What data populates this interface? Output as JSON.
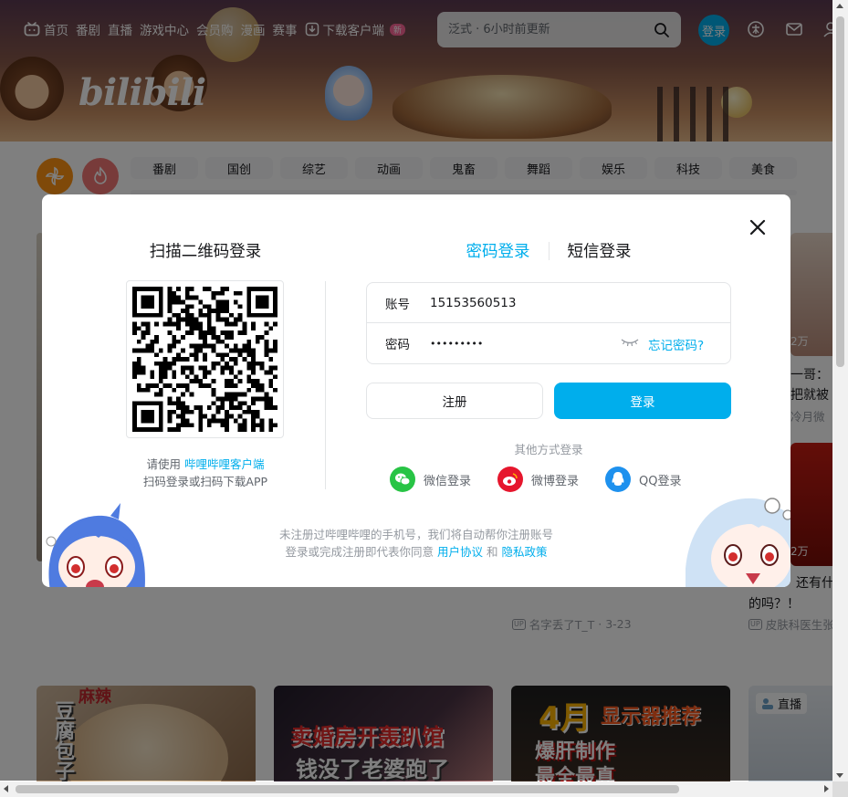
{
  "header": {
    "nav": [
      {
        "label": "首页",
        "icon": "tv-icon"
      },
      {
        "label": "番剧"
      },
      {
        "label": "直播"
      },
      {
        "label": "游戏中心"
      },
      {
        "label": "会员购"
      },
      {
        "label": "漫画"
      },
      {
        "label": "赛事"
      },
      {
        "label": "下载客户端",
        "icon": "download-icon",
        "badge": "新"
      }
    ],
    "search_placeholder": "泛式 · 6小时前更新",
    "login_avatar_label": "登录",
    "banner_logo": "bilibili"
  },
  "channels": {
    "items": [
      "番剧",
      "国创",
      "综艺",
      "动画",
      "鬼畜",
      "舞蹈",
      "娱乐",
      "科技",
      "美食"
    ]
  },
  "feed": {
    "right_card_1": {
      "views": "2万",
      "title_line": "一哥：",
      "title_line2": "把就被",
      "author": "冷月微"
    },
    "right_card_2": {
      "views": "2万",
      "title_line": "还有什",
      "title_line2": "的吗？！",
      "author": "皮肤科医生张"
    },
    "middle_meta": {
      "author": "名字丢了T_T",
      "date": "3-23"
    },
    "bottom_cards": [
      {
        "overlay_text": "麻辣",
        "overlay_text2": "豆腐包子"
      },
      {
        "overlay_text": "卖婚房开轰趴馆",
        "overlay_text2": "钱没了老婆跑了"
      },
      {
        "overlay_text": "4月",
        "overlay_text_b": "显示器推荐",
        "overlay_text2": "爆肝制作",
        "overlay_text3": "最全最真"
      },
      {
        "badge": "直播"
      }
    ]
  },
  "modal": {
    "qr_title": "扫描二维码登录",
    "qr_hint_prefix": "请使用",
    "qr_hint_link": "哔哩哔哩客户端",
    "qr_hint_line2": "扫码登录或扫码下载APP",
    "tab_password": "密码登录",
    "tab_sms": "短信登录",
    "account_label": "账号",
    "account_value": "15153560513",
    "password_label": "密码",
    "password_value": "•••••••••",
    "forgot_password": "忘记密码?",
    "register_button": "注册",
    "login_button": "登录",
    "other_methods_title": "其他方式登录",
    "social": [
      {
        "label": "微信登录",
        "color": "#28c445"
      },
      {
        "label": "微博登录",
        "color": "#e6162d"
      },
      {
        "label": "QQ登录",
        "color": "#1e91ee"
      }
    ],
    "agreement_line1": "未注册过哔哩哔哩的手机号，我们将自动帮你注册账号",
    "agreement_prefix": "登录或完成注册即代表你同意",
    "agreement_user": "用户协议",
    "agreement_and": "和",
    "agreement_privacy": "隐私政策"
  },
  "colors": {
    "accent": "#00aeec",
    "pink": "#fb7299",
    "text": "#18191c",
    "muted": "#9499a0"
  }
}
